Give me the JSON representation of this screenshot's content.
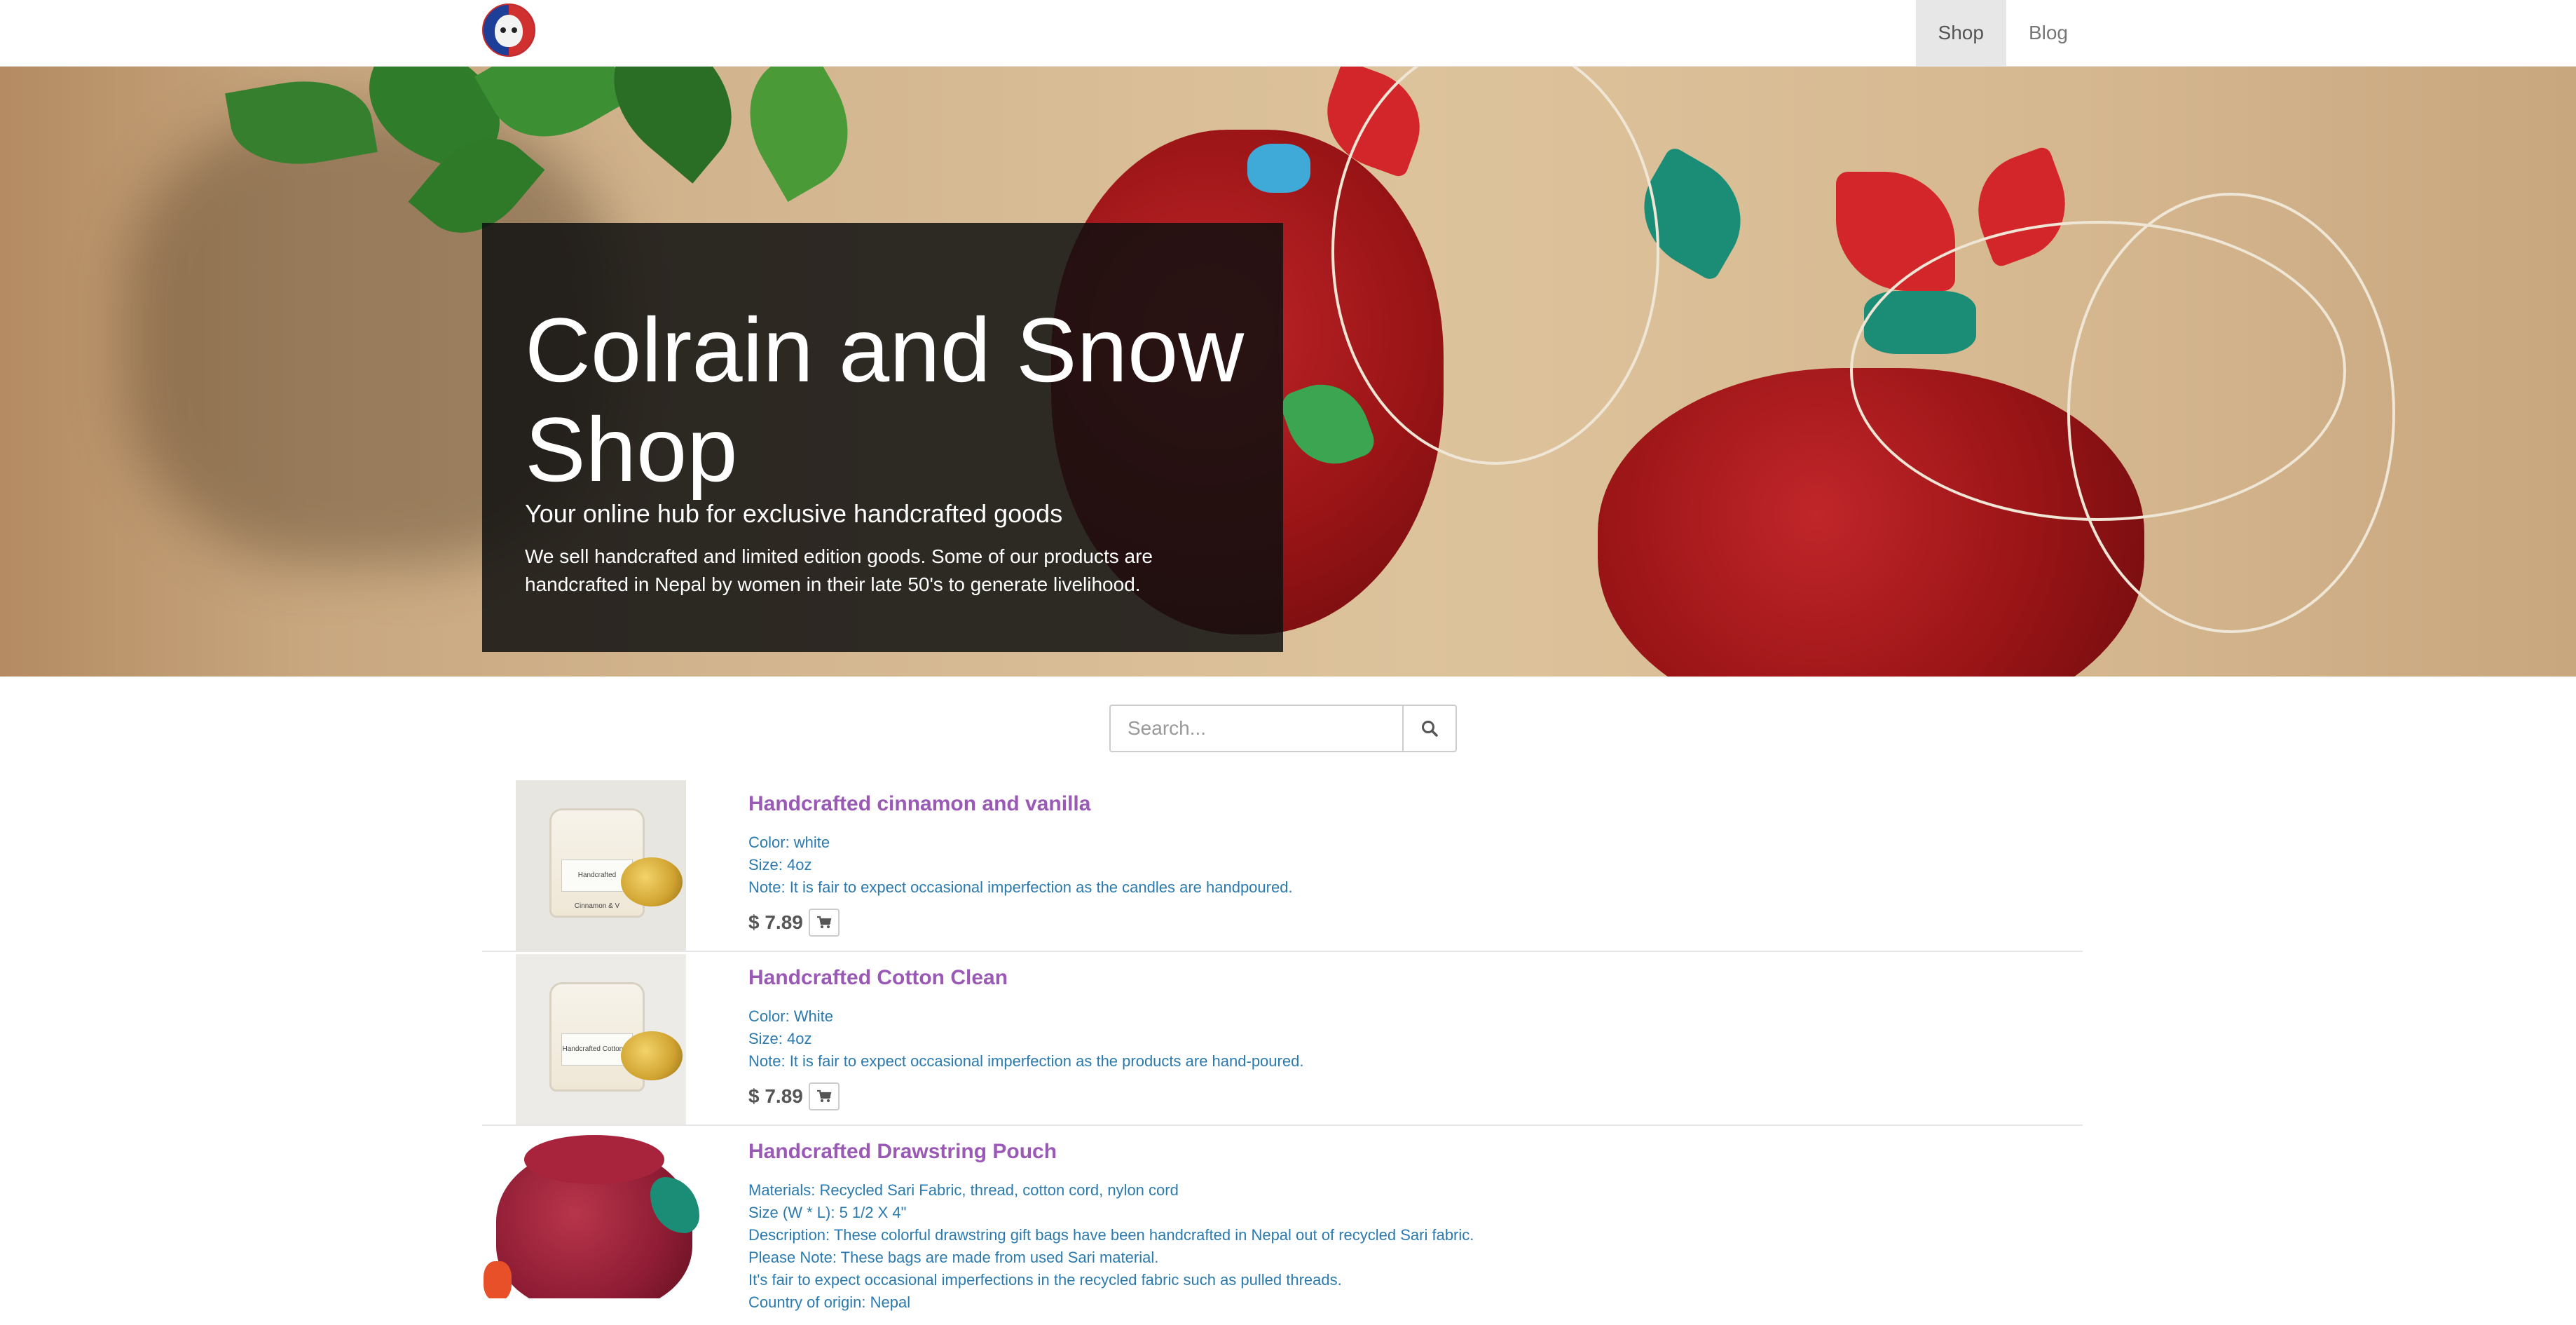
{
  "nav": {
    "logo_alt": "Colrain and Snow logo",
    "links": [
      {
        "label": "Shop",
        "active": true
      },
      {
        "label": "Blog",
        "active": false
      }
    ]
  },
  "hero": {
    "title": "Colrain and Snow Shop",
    "subtitle": "Your online hub for exclusive handcrafted goods",
    "description": "We sell handcrafted and limited edition goods. Some of our products are handcrafted in Nepal by women in their late 50's to generate livelihood."
  },
  "search": {
    "placeholder": "Search..."
  },
  "products": [
    {
      "name": "Handcrafted cinnamon and vanilla",
      "lines": [
        "Color: white",
        "Size: 4oz",
        "Note: It is fair to expect occasional imperfection as the candles are handpoured."
      ],
      "price": "$ 7.89",
      "jar_label": "Handcrafted Cinnamon & V"
    },
    {
      "name": "Handcrafted Cotton Clean",
      "lines": [
        "Color: White",
        "Size: 4oz",
        "Note: It is fair to expect occasional imperfection as the products are hand-poured."
      ],
      "price": "$ 7.89",
      "jar_label": "Handcrafted Cotton Cl"
    },
    {
      "name": "Handcrafted Drawstring Pouch",
      "lines": [
        "Materials: Recycled Sari Fabric, thread, cotton cord, nylon cord",
        "Size (W * L): 5 1/2 X 4\"",
        "Description: These colorful drawstring gift bags have been handcrafted in Nepal out of recycled Sari fabric.",
        "Please Note: These bags are made from used Sari material.",
        "It's fair to expect occasional imperfections in the recycled fabric such as pulled threads.",
        "Country of origin: Nepal"
      ]
    }
  ],
  "colors": {
    "product_name": "#9b59b6",
    "product_detail": "#2a7ab0",
    "nav_active_bg": "#e7e7e7"
  }
}
